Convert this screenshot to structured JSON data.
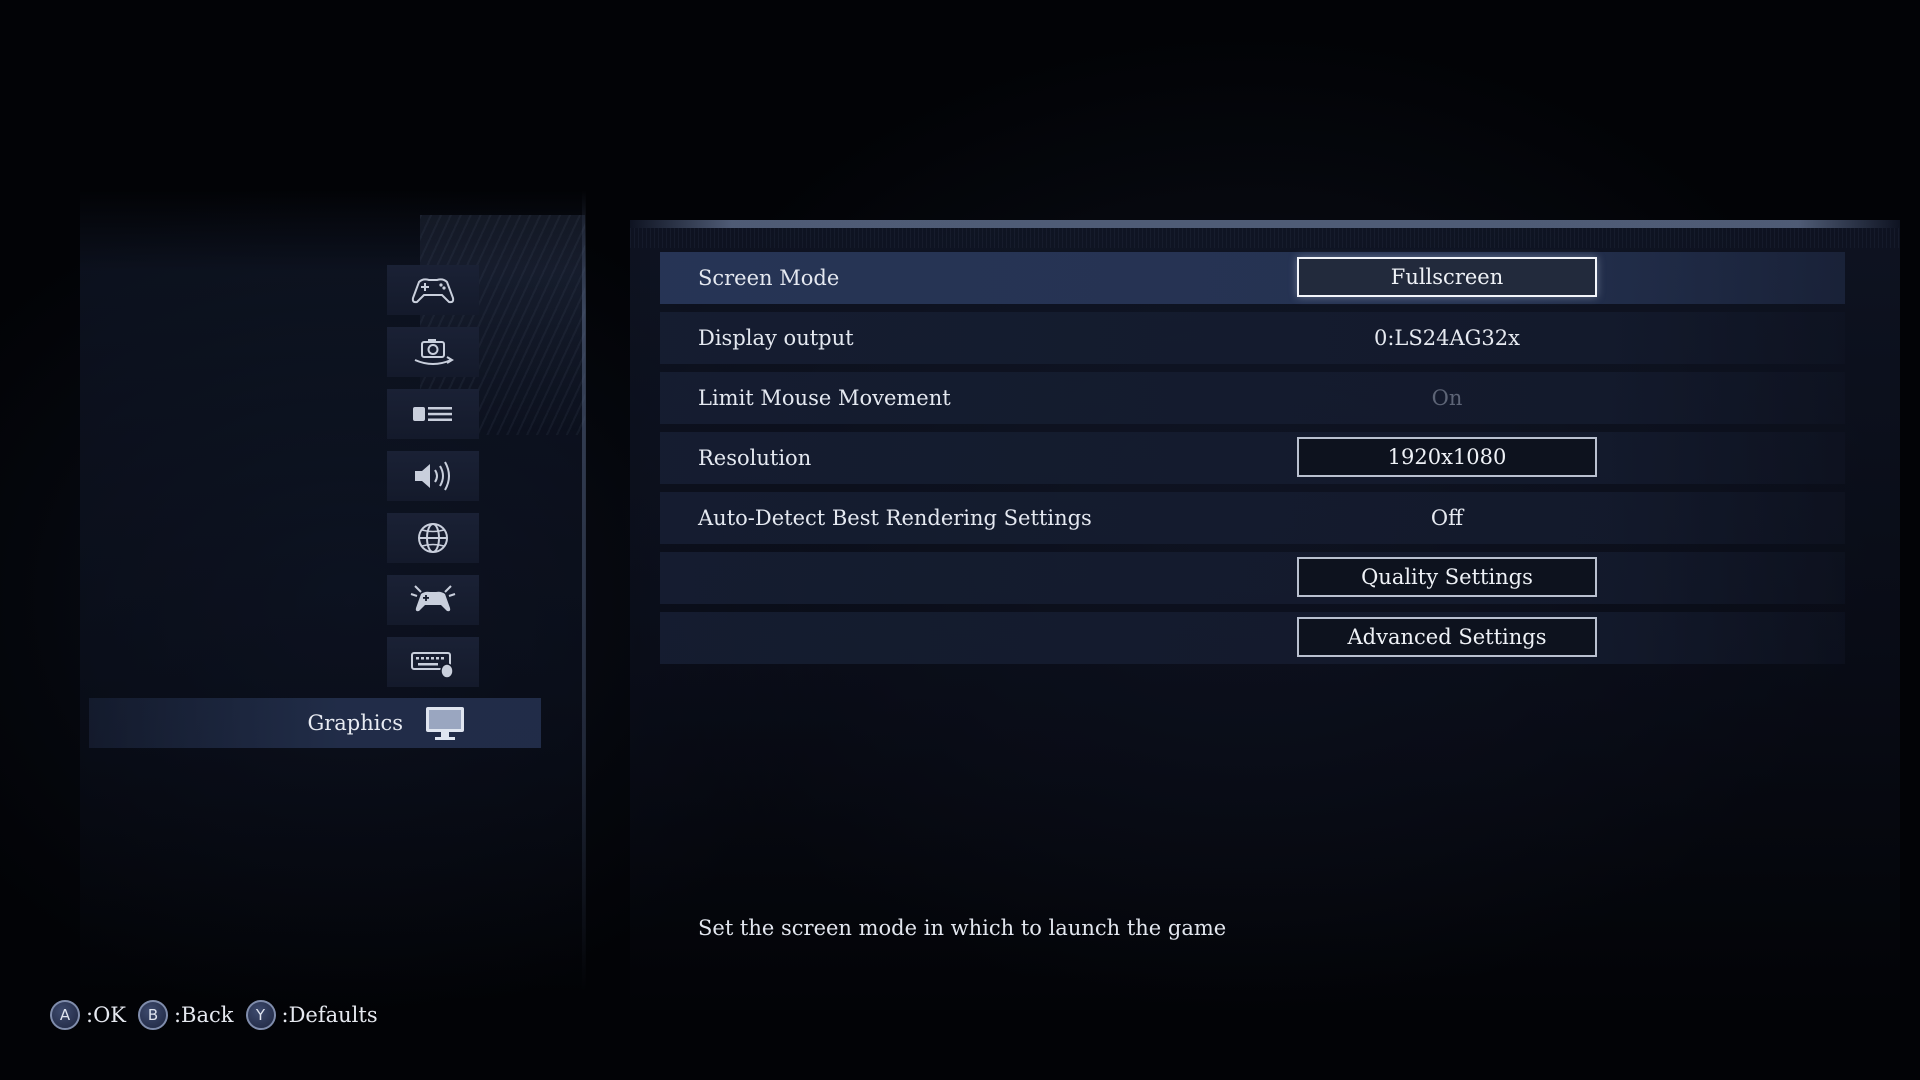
{
  "sidebar": {
    "items": [
      {
        "icon": "gamepad-icon"
      },
      {
        "icon": "camera-rotate-icon"
      },
      {
        "icon": "display-list-icon"
      },
      {
        "icon": "speaker-icon"
      },
      {
        "icon": "globe-icon"
      },
      {
        "icon": "controller-network-icon"
      },
      {
        "icon": "keyboard-mouse-icon"
      }
    ],
    "active": {
      "label": "Graphics",
      "icon": "monitor-icon"
    }
  },
  "settings": [
    {
      "label": "Screen Mode",
      "value": "Fullscreen",
      "kind": "button"
    },
    {
      "label": "Display output",
      "value": "0:LS24AG32x",
      "kind": "text"
    },
    {
      "label": "Limit Mouse Movement",
      "value": "On",
      "kind": "disabled"
    },
    {
      "label": "Resolution",
      "value": "1920x1080",
      "kind": "button"
    },
    {
      "label": "Auto-Detect Best Rendering Settings",
      "value": "Off",
      "kind": "text"
    },
    {
      "label": "",
      "value": "Quality Settings",
      "kind": "button"
    },
    {
      "label": "",
      "value": "Advanced Settings",
      "kind": "button"
    }
  ],
  "description": "Set the screen mode in which to launch the game",
  "footer": {
    "hints": [
      {
        "button": "A",
        "action": ":OK"
      },
      {
        "button": "B",
        "action": ":Back"
      },
      {
        "button": "Y",
        "action": ":Defaults"
      }
    ]
  },
  "colors": {
    "background": "#020306",
    "row": "#161e32",
    "row_selected": "#28365a",
    "button_border": "#b9c0cf",
    "disabled_text": "#5d6476"
  }
}
